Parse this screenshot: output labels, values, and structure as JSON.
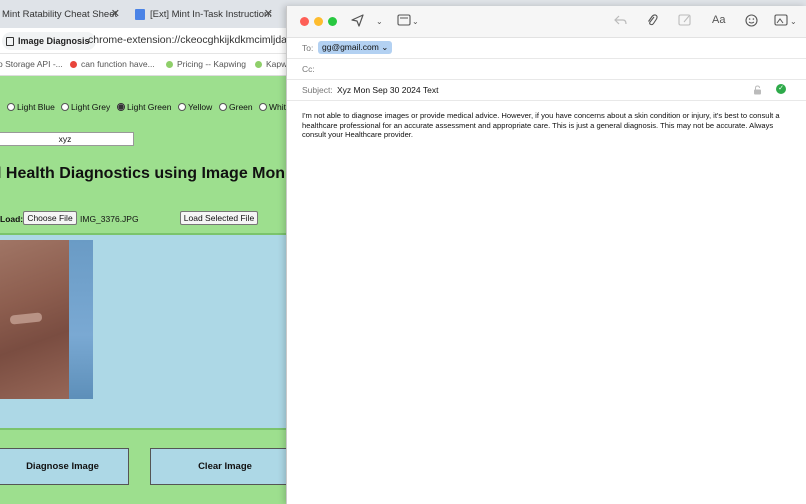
{
  "browser": {
    "tabs": [
      {
        "label": "Mint Ratability Cheat Sheet -"
      },
      {
        "label": "[Ext] Mint In-Task Instruction:"
      }
    ],
    "page_chip": "Image Diagnosis",
    "url": "chrome-extension://ckeocghkijkdkmcimljdaolija",
    "bookmarks": [
      {
        "label": "o Storage API -..."
      },
      {
        "label": "can function have..."
      },
      {
        "label": "Pricing -- Kapwing"
      },
      {
        "label": "Kapw"
      }
    ]
  },
  "page": {
    "color_options": [
      {
        "label": "Light Blue",
        "selected": false
      },
      {
        "label": "Light Grey",
        "selected": false
      },
      {
        "label": "Light Green",
        "selected": true
      },
      {
        "label": "Yellow",
        "selected": false
      },
      {
        "label": "Green",
        "selected": false
      },
      {
        "label": "Whit",
        "selected": false
      }
    ],
    "name_value": "xyz",
    "heading": "l Health Diagnostics using Image Mon Sep",
    "load_label": "Load:",
    "choose_file_label": "Choose File",
    "file_name": "IMG_3376.JPG",
    "load_selected_label": "Load Selected File",
    "diagnose_label": "Diagnose Image",
    "clear_label": "Clear Image"
  },
  "mail": {
    "to_label": "To:",
    "to_value": "gg@gmail.com",
    "cc_label": "Cc:",
    "subject_label": "Subject:",
    "subject_value": "Xyz Mon Sep 30 2024  Text",
    "body": "I'm not able to diagnose images or provide medical advice. However, if you have concerns about a skin condition or injury, it's best to consult a healthcare professional for an accurate assessment and appropriate care. This is just a general diagnosis. This may not be accurate. Always consult your Healthcare provider.",
    "traffic_lights": [
      "#fe5f57",
      "#febc2e",
      "#28c840"
    ]
  },
  "colors": {
    "page_background": "#9ddf8e",
    "image_panel": "#add8e6",
    "token_highlight": "#b3d1f2",
    "send_check": "#2eaa4a"
  }
}
